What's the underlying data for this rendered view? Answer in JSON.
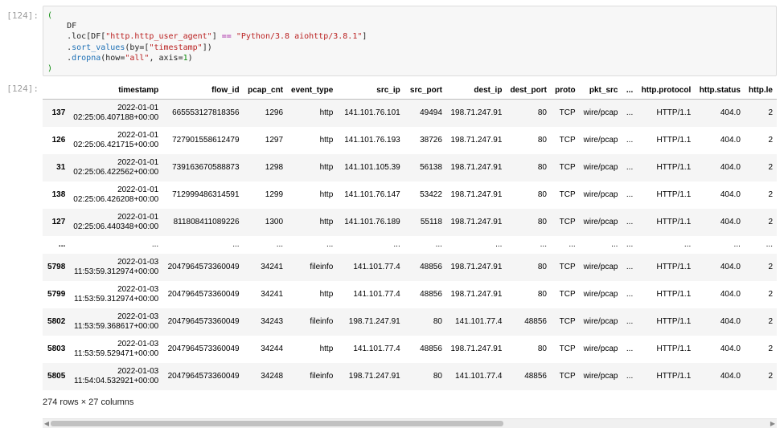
{
  "input_prompt": "[124]:",
  "output_prompt": "[124]:",
  "code_lines": [
    [
      {
        "t": "(",
        "c": "k-paren"
      }
    ],
    [
      {
        "t": "    DF",
        "c": ""
      }
    ],
    [
      {
        "t": "    .loc[DF[",
        "c": ""
      },
      {
        "t": "\"http.http_user_agent\"",
        "c": "k-str"
      },
      {
        "t": "] ",
        "c": ""
      },
      {
        "t": "==",
        "c": "k-op"
      },
      {
        "t": " ",
        "c": ""
      },
      {
        "t": "\"Python/3.8 aiohttp/3.8.1\"",
        "c": "k-str"
      },
      {
        "t": "]",
        "c": ""
      }
    ],
    [
      {
        "t": "    .",
        "c": ""
      },
      {
        "t": "sort_values",
        "c": "k-meth"
      },
      {
        "t": "(by=[",
        "c": ""
      },
      {
        "t": "\"timestamp\"",
        "c": "k-str"
      },
      {
        "t": "])",
        "c": ""
      }
    ],
    [
      {
        "t": "    .",
        "c": ""
      },
      {
        "t": "dropna",
        "c": "k-meth"
      },
      {
        "t": "(how=",
        "c": ""
      },
      {
        "t": "\"all\"",
        "c": "k-str"
      },
      {
        "t": ", axis=",
        "c": ""
      },
      {
        "t": "1",
        "c": "k-num"
      },
      {
        "t": ")",
        "c": ""
      }
    ],
    [
      {
        "t": ")",
        "c": "k-paren"
      }
    ]
  ],
  "table": {
    "columns": [
      "",
      "timestamp",
      "flow_id",
      "pcap_cnt",
      "event_type",
      "src_ip",
      "src_port",
      "dest_ip",
      "dest_port",
      "proto",
      "pkt_src",
      "...",
      "http.protocol",
      "http.status",
      "http.le"
    ],
    "rows": [
      {
        "idx": "137",
        "ts_date": "2022-01-01",
        "ts_time": "02:25:06.407188+00:00",
        "cells": [
          "665553127818356",
          "1296",
          "http",
          "141.101.76.101",
          "49494",
          "198.71.247.91",
          "80",
          "TCP",
          "wire/pcap",
          "...",
          "HTTP/1.1",
          "404.0",
          "2"
        ]
      },
      {
        "idx": "126",
        "ts_date": "2022-01-01",
        "ts_time": "02:25:06.421715+00:00",
        "cells": [
          "727901558612479",
          "1297",
          "http",
          "141.101.76.193",
          "38726",
          "198.71.247.91",
          "80",
          "TCP",
          "wire/pcap",
          "...",
          "HTTP/1.1",
          "404.0",
          "2"
        ]
      },
      {
        "idx": "31",
        "ts_date": "2022-01-01",
        "ts_time": "02:25:06.422562+00:00",
        "cells": [
          "739163670588873",
          "1298",
          "http",
          "141.101.105.39",
          "56138",
          "198.71.247.91",
          "80",
          "TCP",
          "wire/pcap",
          "...",
          "HTTP/1.1",
          "404.0",
          "2"
        ]
      },
      {
        "idx": "138",
        "ts_date": "2022-01-01",
        "ts_time": "02:25:06.426208+00:00",
        "cells": [
          "712999486314591",
          "1299",
          "http",
          "141.101.76.147",
          "53422",
          "198.71.247.91",
          "80",
          "TCP",
          "wire/pcap",
          "...",
          "HTTP/1.1",
          "404.0",
          "2"
        ]
      },
      {
        "idx": "127",
        "ts_date": "2022-01-01",
        "ts_time": "02:25:06.440348+00:00",
        "cells": [
          "811808411089226",
          "1300",
          "http",
          "141.101.76.189",
          "55118",
          "198.71.247.91",
          "80",
          "TCP",
          "wire/pcap",
          "...",
          "HTTP/1.1",
          "404.0",
          "2"
        ]
      },
      {
        "ellipsis": true,
        "idx": "...",
        "ts_date": "...",
        "ts_time": "",
        "cells": [
          "...",
          "...",
          "...",
          "...",
          "...",
          "...",
          "...",
          "...",
          "...",
          "...",
          "...",
          "...",
          "..."
        ]
      },
      {
        "idx": "5798",
        "ts_date": "2022-01-03",
        "ts_time": "11:53:59.312974+00:00",
        "cells": [
          "2047964573360049",
          "34241",
          "fileinfo",
          "141.101.77.4",
          "48856",
          "198.71.247.91",
          "80",
          "TCP",
          "wire/pcap",
          "...",
          "HTTP/1.1",
          "404.0",
          "2"
        ]
      },
      {
        "idx": "5799",
        "ts_date": "2022-01-03",
        "ts_time": "11:53:59.312974+00:00",
        "cells": [
          "2047964573360049",
          "34241",
          "http",
          "141.101.77.4",
          "48856",
          "198.71.247.91",
          "80",
          "TCP",
          "wire/pcap",
          "...",
          "HTTP/1.1",
          "404.0",
          "2"
        ]
      },
      {
        "idx": "5802",
        "ts_date": "2022-01-03",
        "ts_time": "11:53:59.368617+00:00",
        "cells": [
          "2047964573360049",
          "34243",
          "fileinfo",
          "198.71.247.91",
          "80",
          "141.101.77.4",
          "48856",
          "TCP",
          "wire/pcap",
          "...",
          "HTTP/1.1",
          "404.0",
          "2"
        ]
      },
      {
        "idx": "5803",
        "ts_date": "2022-01-03",
        "ts_time": "11:53:59.529471+00:00",
        "cells": [
          "2047964573360049",
          "34244",
          "http",
          "141.101.77.4",
          "48856",
          "198.71.247.91",
          "80",
          "TCP",
          "wire/pcap",
          "...",
          "HTTP/1.1",
          "404.0",
          "2"
        ]
      },
      {
        "idx": "5805",
        "ts_date": "2022-01-03",
        "ts_time": "11:54:04.532921+00:00",
        "cells": [
          "2047964573360049",
          "34248",
          "fileinfo",
          "198.71.247.91",
          "80",
          "141.101.77.4",
          "48856",
          "TCP",
          "wire/pcap",
          "...",
          "HTTP/1.1",
          "404.0",
          "2"
        ]
      }
    ]
  },
  "footer": "274 rows × 27 columns",
  "scrollbar": {
    "thumb_fraction": 0.63
  },
  "colors": {
    "string": "#ba2121",
    "method": "#1c6fb5",
    "paren": "#0a8a0a"
  }
}
